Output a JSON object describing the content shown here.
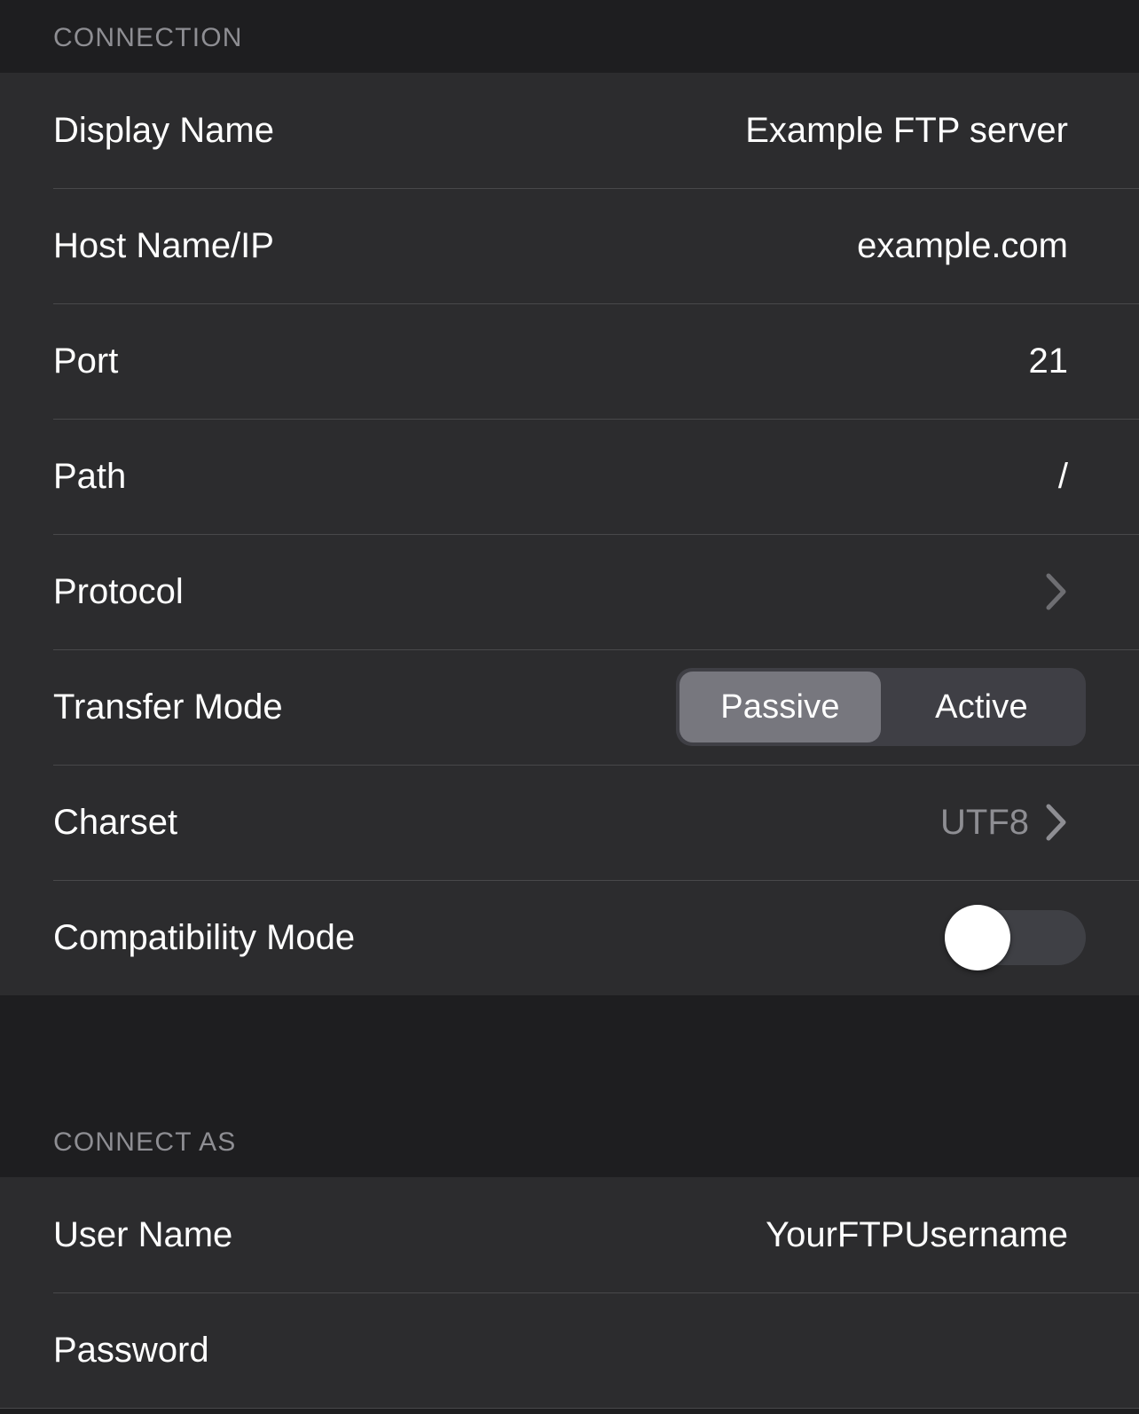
{
  "screen": {
    "background": "#1e1e20",
    "row_background": "#2c2c2e",
    "separator": "#48484a",
    "label_color": "#ffffff",
    "muted_color": "#8e8e93"
  },
  "sections": [
    {
      "header": "CONNECTION",
      "rows": [
        {
          "label": "Display Name",
          "value": "Example FTP server",
          "type": "text"
        },
        {
          "label": "Host Name/IP",
          "value": "example.com",
          "type": "text"
        },
        {
          "label": "Port",
          "value": "21",
          "type": "text"
        },
        {
          "label": "Path",
          "value": "/",
          "type": "text"
        },
        {
          "label": "Protocol",
          "value": "",
          "type": "disclosure",
          "icon": "chevron-right-icon"
        },
        {
          "label": "Transfer Mode",
          "type": "segmented",
          "options": [
            "Passive",
            "Active"
          ],
          "selected": "Passive",
          "selected_color": "#77777e",
          "track_color": "#3f3f45"
        },
        {
          "label": "Charset",
          "value": "UTF8",
          "type": "disclosure",
          "icon": "chevron-right-icon"
        },
        {
          "label": "Compatibility Mode",
          "type": "switch",
          "on": false,
          "track_color": "#3f4045",
          "knob_color": "#ffffff"
        }
      ]
    },
    {
      "header": "CONNECT AS",
      "rows": [
        {
          "label": "User Name",
          "value": "YourFTPUsername",
          "type": "text"
        },
        {
          "label": "Password",
          "value": "",
          "type": "text"
        }
      ]
    }
  ]
}
